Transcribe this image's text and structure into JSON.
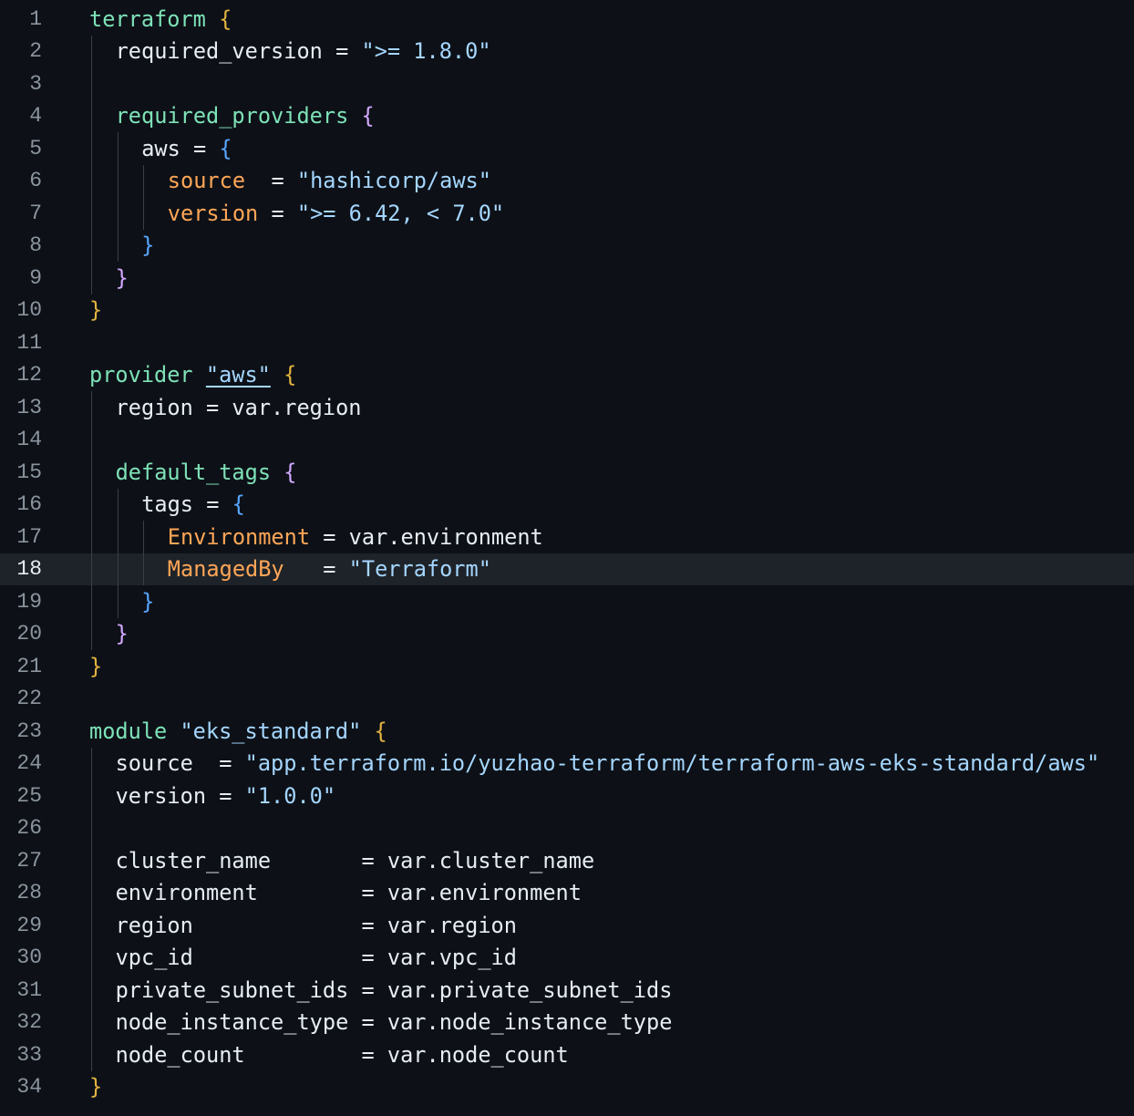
{
  "editor": {
    "current_line": 18,
    "lines": [
      {
        "n": "1",
        "indent": 0,
        "tokens": [
          {
            "t": "terraform",
            "c": "k"
          },
          {
            "t": " ",
            "c": "t"
          },
          {
            "t": "{",
            "c": "by"
          }
        ]
      },
      {
        "n": "2",
        "indent": 1,
        "tokens": [
          {
            "t": "required_version = ",
            "c": "t"
          },
          {
            "t": "\">= 1.8.0\"",
            "c": "s"
          }
        ]
      },
      {
        "n": "3",
        "indent": 0,
        "tokens": []
      },
      {
        "n": "4",
        "indent": 1,
        "tokens": [
          {
            "t": "required_providers",
            "c": "k"
          },
          {
            "t": " ",
            "c": "t"
          },
          {
            "t": "{",
            "c": "bm"
          }
        ]
      },
      {
        "n": "5",
        "indent": 2,
        "tokens": [
          {
            "t": "aws = ",
            "c": "t"
          },
          {
            "t": "{",
            "c": "bb"
          }
        ]
      },
      {
        "n": "6",
        "indent": 3,
        "tokens": [
          {
            "t": "source",
            "c": "p"
          },
          {
            "t": "  = ",
            "c": "t"
          },
          {
            "t": "\"hashicorp/aws\"",
            "c": "s"
          }
        ]
      },
      {
        "n": "7",
        "indent": 3,
        "tokens": [
          {
            "t": "version",
            "c": "p"
          },
          {
            "t": " = ",
            "c": "t"
          },
          {
            "t": "\">= 6.42, < 7.0\"",
            "c": "s"
          }
        ]
      },
      {
        "n": "8",
        "indent": 2,
        "tokens": [
          {
            "t": "}",
            "c": "bb"
          }
        ]
      },
      {
        "n": "9",
        "indent": 1,
        "tokens": [
          {
            "t": "}",
            "c": "bm"
          }
        ]
      },
      {
        "n": "10",
        "indent": 0,
        "tokens": [
          {
            "t": "}",
            "c": "by"
          }
        ]
      },
      {
        "n": "11",
        "indent": 0,
        "tokens": []
      },
      {
        "n": "12",
        "indent": 0,
        "tokens": [
          {
            "t": "provider",
            "c": "k"
          },
          {
            "t": " ",
            "c": "t"
          },
          {
            "t": "\"aws\"",
            "c": "u"
          },
          {
            "t": " ",
            "c": "t"
          },
          {
            "t": "{",
            "c": "by"
          }
        ]
      },
      {
        "n": "13",
        "indent": 1,
        "tokens": [
          {
            "t": "region = var.region",
            "c": "t"
          }
        ]
      },
      {
        "n": "14",
        "indent": 0,
        "tokens": []
      },
      {
        "n": "15",
        "indent": 1,
        "tokens": [
          {
            "t": "default_tags",
            "c": "k"
          },
          {
            "t": " ",
            "c": "t"
          },
          {
            "t": "{",
            "c": "bm"
          }
        ]
      },
      {
        "n": "16",
        "indent": 2,
        "tokens": [
          {
            "t": "tags = ",
            "c": "t"
          },
          {
            "t": "{",
            "c": "bb"
          }
        ]
      },
      {
        "n": "17",
        "indent": 3,
        "tokens": [
          {
            "t": "Environment",
            "c": "p"
          },
          {
            "t": " = var.environment",
            "c": "t"
          }
        ]
      },
      {
        "n": "18",
        "indent": 3,
        "tokens": [
          {
            "t": "ManagedBy",
            "c": "p"
          },
          {
            "t": "   = ",
            "c": "t"
          },
          {
            "t": "\"Terraform\"",
            "c": "s"
          }
        ]
      },
      {
        "n": "19",
        "indent": 2,
        "tokens": [
          {
            "t": "}",
            "c": "bb"
          }
        ]
      },
      {
        "n": "20",
        "indent": 1,
        "tokens": [
          {
            "t": "}",
            "c": "bm"
          }
        ]
      },
      {
        "n": "21",
        "indent": 0,
        "tokens": [
          {
            "t": "}",
            "c": "by"
          }
        ]
      },
      {
        "n": "22",
        "indent": 0,
        "tokens": []
      },
      {
        "n": "23",
        "indent": 0,
        "tokens": [
          {
            "t": "module",
            "c": "k"
          },
          {
            "t": " ",
            "c": "t"
          },
          {
            "t": "\"eks_standard\"",
            "c": "s"
          },
          {
            "t": " ",
            "c": "t"
          },
          {
            "t": "{",
            "c": "by"
          }
        ]
      },
      {
        "n": "24",
        "indent": 1,
        "tokens": [
          {
            "t": "source  = ",
            "c": "t"
          },
          {
            "t": "\"app.terraform.io/yuzhao-terraform/terraform-aws-eks-standard/aws\"",
            "c": "s"
          }
        ]
      },
      {
        "n": "25",
        "indent": 1,
        "tokens": [
          {
            "t": "version = ",
            "c": "t"
          },
          {
            "t": "\"1.0.0\"",
            "c": "s"
          }
        ]
      },
      {
        "n": "26",
        "indent": 0,
        "tokens": []
      },
      {
        "n": "27",
        "indent": 1,
        "tokens": [
          {
            "t": "cluster_name       = var.cluster_name",
            "c": "t"
          }
        ]
      },
      {
        "n": "28",
        "indent": 1,
        "tokens": [
          {
            "t": "environment        = var.environment",
            "c": "t"
          }
        ]
      },
      {
        "n": "29",
        "indent": 1,
        "tokens": [
          {
            "t": "region             = var.region",
            "c": "t"
          }
        ]
      },
      {
        "n": "30",
        "indent": 1,
        "tokens": [
          {
            "t": "vpc_id             = var.vpc_id",
            "c": "t"
          }
        ]
      },
      {
        "n": "31",
        "indent": 1,
        "tokens": [
          {
            "t": "private_subnet_ids = var.private_subnet_ids",
            "c": "t"
          }
        ]
      },
      {
        "n": "32",
        "indent": 1,
        "tokens": [
          {
            "t": "node_instance_type = var.node_instance_type",
            "c": "t"
          }
        ]
      },
      {
        "n": "33",
        "indent": 1,
        "tokens": [
          {
            "t": "node_count         = var.node_count",
            "c": "t"
          }
        ]
      },
      {
        "n": "34",
        "indent": 0,
        "tokens": [
          {
            "t": "}",
            "c": "by"
          }
        ]
      }
    ]
  }
}
